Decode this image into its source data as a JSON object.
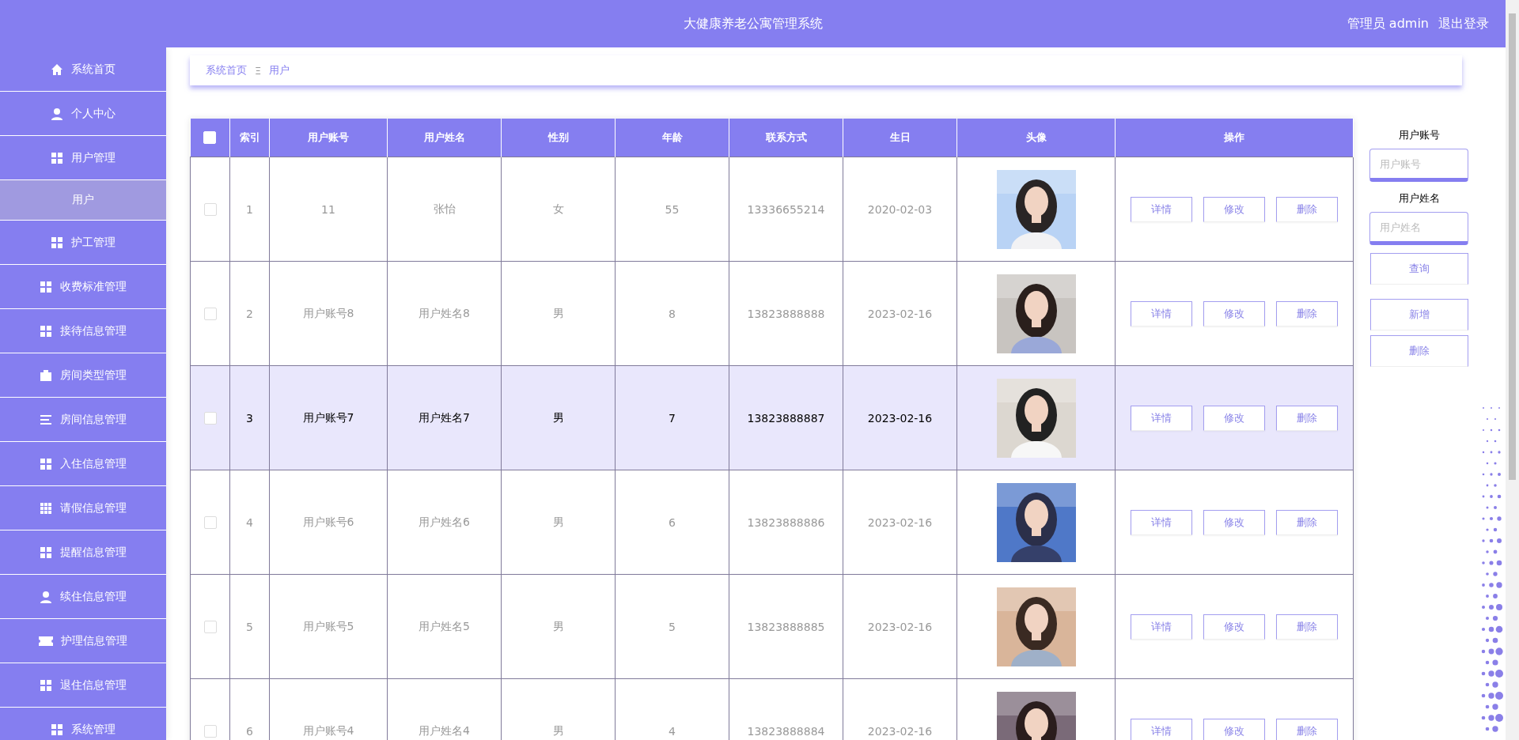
{
  "header": {
    "title": "大健康养老公寓管理系统",
    "user": "管理员 admin",
    "logout": "退出登录"
  },
  "sidebar": {
    "items": [
      {
        "label": "系统首页",
        "kind": "home",
        "selected": false
      },
      {
        "label": "个人中心",
        "kind": "user",
        "selected": false
      },
      {
        "label": "用户管理",
        "kind": "grid",
        "selected": false,
        "children": [
          {
            "label": "用户",
            "selected": true
          }
        ]
      },
      {
        "label": "护工管理",
        "kind": "grid",
        "selected": false
      },
      {
        "label": "收费标准管理",
        "kind": "grid",
        "selected": false
      },
      {
        "label": "接待信息管理",
        "kind": "grid",
        "selected": false
      },
      {
        "label": "房间类型管理",
        "kind": "briefcase",
        "selected": false
      },
      {
        "label": "房间信息管理",
        "kind": "list",
        "selected": false
      },
      {
        "label": "入住信息管理",
        "kind": "grid",
        "selected": false
      },
      {
        "label": "请假信息管理",
        "kind": "table",
        "selected": false
      },
      {
        "label": "提醒信息管理",
        "kind": "grid",
        "selected": false
      },
      {
        "label": "续住信息管理",
        "kind": "user",
        "selected": false
      },
      {
        "label": "护理信息管理",
        "kind": "ticket",
        "selected": false
      },
      {
        "label": "退住信息管理",
        "kind": "grid",
        "selected": false
      },
      {
        "label": "系统管理",
        "kind": "grid",
        "selected": false
      }
    ]
  },
  "breadcrumb": {
    "items": [
      "系统首页",
      "用户"
    ],
    "separator": "Ξ"
  },
  "table": {
    "select_all_checked": false,
    "columns": [
      "索引",
      "用户账号",
      "用户姓名",
      "性别",
      "年龄",
      "联系方式",
      "生日",
      "头像",
      "操作"
    ],
    "rows": [
      {
        "checked": false,
        "hovered": false,
        "cells": [
          "1",
          "11",
          "张怡",
          "女",
          "55",
          "13336655214",
          "2020-02-03"
        ],
        "actions": [
          "详情",
          "修改",
          "删除"
        ]
      },
      {
        "checked": false,
        "hovered": false,
        "cells": [
          "2",
          "用户账号8",
          "用户姓名8",
          "男",
          "8",
          "13823888888",
          "2023-02-16"
        ],
        "actions": [
          "详情",
          "修改",
          "删除"
        ]
      },
      {
        "checked": false,
        "hovered": true,
        "cells": [
          "3",
          "用户账号7",
          "用户姓名7",
          "男",
          "7",
          "13823888887",
          "2023-02-16"
        ],
        "actions": [
          "详情",
          "修改",
          "删除"
        ]
      },
      {
        "checked": false,
        "hovered": false,
        "cells": [
          "4",
          "用户账号6",
          "用户姓名6",
          "男",
          "6",
          "13823888886",
          "2023-02-16"
        ],
        "actions": [
          "详情",
          "修改",
          "删除"
        ]
      },
      {
        "checked": false,
        "hovered": false,
        "cells": [
          "5",
          "用户账号5",
          "用户姓名5",
          "男",
          "5",
          "13823888885",
          "2023-02-16"
        ],
        "actions": [
          "详情",
          "修改",
          "删除"
        ]
      },
      {
        "checked": false,
        "hovered": false,
        "cells": [
          "6",
          "用户账号4",
          "用户姓名4",
          "男",
          "4",
          "13823888884",
          "2023-02-16"
        ],
        "actions": [
          "详情",
          "修改",
          "删除"
        ]
      }
    ]
  },
  "search": {
    "fields": [
      {
        "label": "用户账号",
        "placeholder": "用户账号"
      },
      {
        "label": "用户姓名",
        "placeholder": "用户姓名"
      }
    ],
    "query_button": "查询",
    "add_button": "新增",
    "delete_button": "删除"
  }
}
